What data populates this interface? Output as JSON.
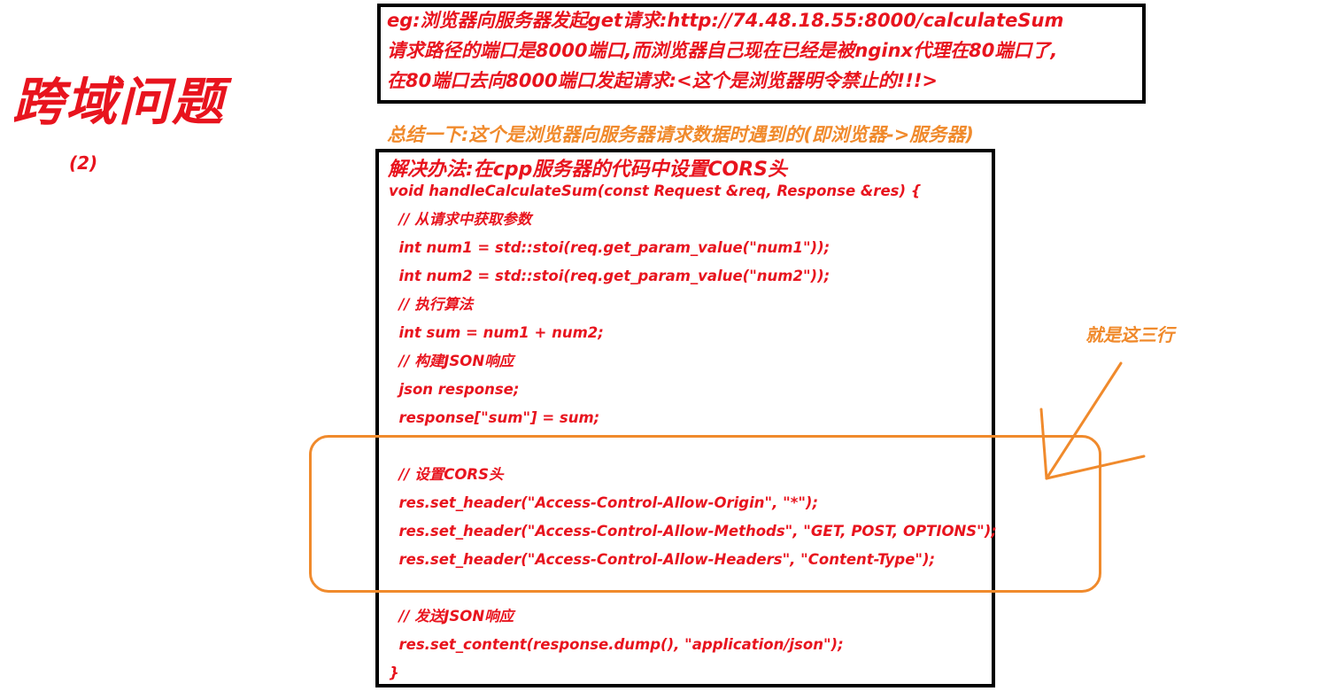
{
  "title": "跨域问题",
  "subtitle": "(2)",
  "top_note": {
    "lines": [
      "eg:浏览器向服务器发起get请求:http://74.48.18.55:8000/calculateSum",
      "请求路径的端口是8000端口,而浏览器自己现在已经是被nginx代理在80端口了,",
      "在80端口去向8000端口发起请求:<这个是浏览器明令禁止的!!!>"
    ]
  },
  "summary": "总结一下:这个是浏览器向服务器请求数据时遇到的(即浏览器->服务器)",
  "code_block": {
    "heading": "解决办法:在cpp服务器的代码中设置CORS头",
    "lines": [
      "void handleCalculateSum(const Request &req, Response &res) {",
      "  // 从请求中获取参数",
      "  int num1 = std::stoi(req.get_param_value(\"num1\"));",
      "  int num2 = std::stoi(req.get_param_value(\"num2\"));",
      "  // 执行算法",
      "  int sum = num1 + num2;",
      "  // 构建JSON响应",
      "  json response;",
      "  response[\"sum\"] = sum;",
      "",
      "  // 设置CORS头",
      "  res.set_header(\"Access-Control-Allow-Origin\", \"*\");",
      "  res.set_header(\"Access-Control-Allow-Methods\", \"GET, POST, OPTIONS\");",
      "  res.set_header(\"Access-Control-Allow-Headers\", \"Content-Type\");",
      "",
      "  // 发送JSON响应",
      "  res.set_content(response.dump(), \"application/json\");",
      "}"
    ]
  },
  "callout": "就是这三行",
  "colors": {
    "text_red": "#e8141e",
    "annotation_orange": "#f08a2c",
    "box_border": "#000000"
  }
}
